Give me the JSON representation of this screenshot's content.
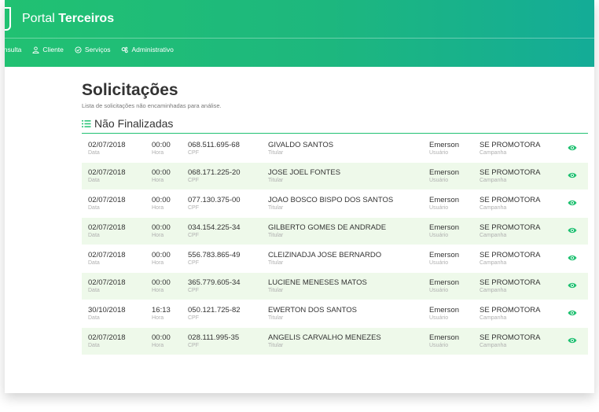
{
  "brand": {
    "prefix": "Portal",
    "bold": "Terceiros"
  },
  "nav": [
    {
      "label": "onsulta",
      "icon": "search-icon"
    },
    {
      "label": "Cliente",
      "icon": "user-icon"
    },
    {
      "label": "Serviços",
      "icon": "check-circle-icon"
    },
    {
      "label": "Administrativo",
      "icon": "gears-icon"
    }
  ],
  "page": {
    "title": "Solicitações",
    "subtitle": "Lista de solicitações não encaminhadas para análise.",
    "section_title": "Não Finalizadas"
  },
  "labels": {
    "data": "Data",
    "hora": "Hora",
    "cpf": "CPF",
    "titular": "Titular",
    "usuario": "Usuário",
    "campanha": "Campanha"
  },
  "rows": [
    {
      "data": "02/07/2018",
      "hora": "00:00",
      "cpf": "068.511.695-68",
      "titular": "GIVALDO SANTOS",
      "usuario": "Emerson",
      "campanha": "SE PROMOTORA"
    },
    {
      "data": "02/07/2018",
      "hora": "00:00",
      "cpf": "068.171.225-20",
      "titular": "JOSE JOEL FONTES",
      "usuario": "Emerson",
      "campanha": "SE PROMOTORA"
    },
    {
      "data": "02/07/2018",
      "hora": "00:00",
      "cpf": "077.130.375-00",
      "titular": "JOAO BOSCO BISPO DOS SANTOS",
      "usuario": "Emerson",
      "campanha": "SE PROMOTORA"
    },
    {
      "data": "02/07/2018",
      "hora": "00:00",
      "cpf": "034.154.225-34",
      "titular": "GILBERTO GOMES DE ANDRADE",
      "usuario": "Emerson",
      "campanha": "SE PROMOTORA"
    },
    {
      "data": "02/07/2018",
      "hora": "00:00",
      "cpf": "556.783.865-49",
      "titular": "CLEIZINADJA JOSE BERNARDO",
      "usuario": "Emerson",
      "campanha": "SE PROMOTORA"
    },
    {
      "data": "02/07/2018",
      "hora": "00:00",
      "cpf": "365.779.605-34",
      "titular": "LUCIENE MENESES MATOS",
      "usuario": "Emerson",
      "campanha": "SE PROMOTORA"
    },
    {
      "data": "30/10/2018",
      "hora": "16:13",
      "cpf": "050.121.725-82",
      "titular": "EWERTON DOS SANTOS",
      "usuario": "Emerson",
      "campanha": "SE PROMOTORA"
    },
    {
      "data": "02/07/2018",
      "hora": "00:00",
      "cpf": "028.111.995-35",
      "titular": "ANGELIS CARVALHO MENEZES",
      "usuario": "Emerson",
      "campanha": "SE PROMOTORA"
    }
  ],
  "colors": {
    "accent": "#21c172",
    "row_alt": "#eef9ea"
  }
}
